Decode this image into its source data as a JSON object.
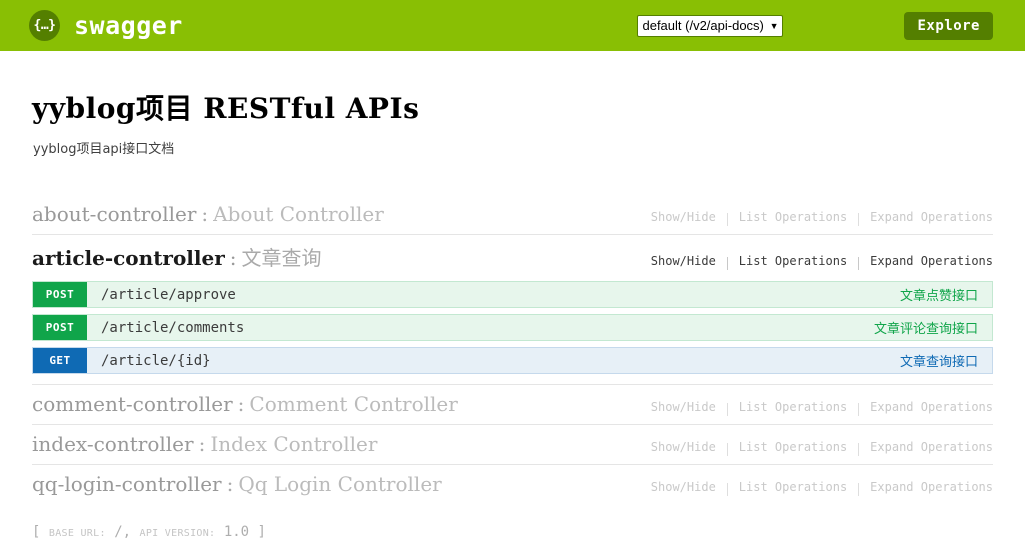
{
  "header": {
    "logo_icon": "swagger-braces-icon",
    "logo_text": "swagger",
    "api_select_value": "default (/v2/api-docs)",
    "api_select_caret": "▼",
    "explore_label": "Explore",
    "bar_color": "#89bf04",
    "accent_dark": "#547f00"
  },
  "info": {
    "title": "yyblog项目 RESTful APIs",
    "description": "yyblog项目api接口文档"
  },
  "options_labels": {
    "show_hide": "Show/Hide",
    "list_operations": "List Operations",
    "expand_operations": "Expand Operations"
  },
  "resources": [
    {
      "name": "about-controller",
      "colon": ":",
      "description": "About Controller",
      "active": false,
      "operations": []
    },
    {
      "name": "article-controller",
      "colon": ":",
      "description": "文章查询",
      "active": true,
      "operations": [
        {
          "method": "POST",
          "path": "/article/approve",
          "summary": "文章点赞接口",
          "color": "#10a54a"
        },
        {
          "method": "POST",
          "path": "/article/comments",
          "summary": "文章评论查询接口",
          "color": "#10a54a"
        },
        {
          "method": "GET",
          "path": "/article/{id}",
          "summary": "文章查询接口",
          "color": "#0f6ab4"
        }
      ]
    },
    {
      "name": "comment-controller",
      "colon": ":",
      "description": "Comment Controller",
      "active": false,
      "operations": []
    },
    {
      "name": "index-controller",
      "colon": ":",
      "description": "Index Controller",
      "active": false,
      "operations": []
    },
    {
      "name": "qq-login-controller",
      "colon": ":",
      "description": "Qq Login Controller",
      "active": false,
      "operations": []
    }
  ],
  "footer": {
    "open_bracket": "[",
    "base_url_label": "BASE URL:",
    "base_url_value": "/",
    "comma": ",",
    "api_version_label": "API VERSION:",
    "api_version_value": "1.0",
    "close_bracket": "]"
  }
}
